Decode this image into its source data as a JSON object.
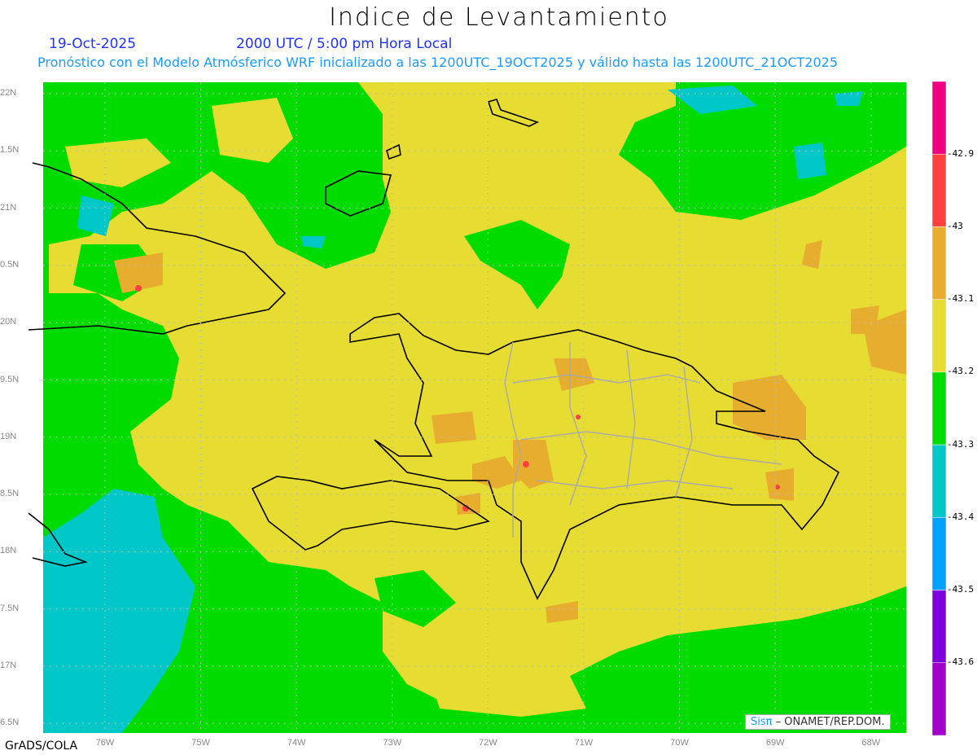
{
  "header": {
    "title": "Indice de Levantamiento",
    "date": "19-Oct-2025",
    "time": "2000 UTC / 5:00 pm Hora Local",
    "subtitle": "Pronóstico con el Modelo Atmósferico WRF inicializado a las 1200UTC_19OCT2025 y válido hasta las  1200UTC_21OCT2025"
  },
  "map": {
    "lat_labels": [
      "22N",
      "1.5N",
      "21N",
      "0.5N",
      "20N",
      "9.5N",
      "19N",
      "8.5N",
      "18N",
      "7.5N",
      "17N",
      "6.5N"
    ],
    "lon_labels": [
      "76W",
      "75W",
      "74W",
      "73W",
      "72W",
      "71W",
      "70W",
      "69W",
      "68W"
    ],
    "lon_range": [
      -76.65,
      -67.6
    ],
    "lat_range": [
      16.4,
      22.1
    ]
  },
  "colorbar": {
    "colors": [
      "#ee0080",
      "#ff4040",
      "#e6ad2e",
      "#e6dc32",
      "#00dc00",
      "#00c8c8",
      "#00a0ff",
      "#8000dc",
      "#a000c8"
    ],
    "labels": [
      "-42.9",
      "-43",
      "-43.1",
      "-43.2",
      "-43.3",
      "-43.4",
      "-43.5",
      "-43.6"
    ]
  },
  "footer": {
    "grads": "GrADS/COLA",
    "credit_brand": "Sisπ",
    "credit_text": "– ONAMET/REP.DOM."
  }
}
